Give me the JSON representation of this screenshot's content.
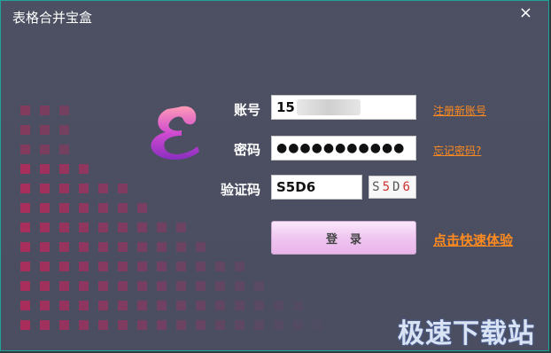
{
  "window": {
    "title": "表格合并宝盒",
    "close_symbol": "×"
  },
  "form": {
    "account_label": "账号",
    "account_value": "15",
    "password_label": "密码",
    "password_value": "●●●●●●●●●●●",
    "captcha_label": "验证码",
    "captcha_input_value": "S5D6",
    "captcha_image_text": "S5D6"
  },
  "links": {
    "register": "注册新账号",
    "forgot": "忘记密码?"
  },
  "buttons": {
    "login": "登录",
    "quick_experience": "点击快速体验"
  },
  "watermark": "极速下载站",
  "colors": {
    "background": "#4b4f61",
    "link": "#ff8a1f",
    "button": "#f0c6f1",
    "logo": "#c64fc9"
  },
  "icons": {
    "logo": "app-logo-icon",
    "close": "close-icon"
  }
}
